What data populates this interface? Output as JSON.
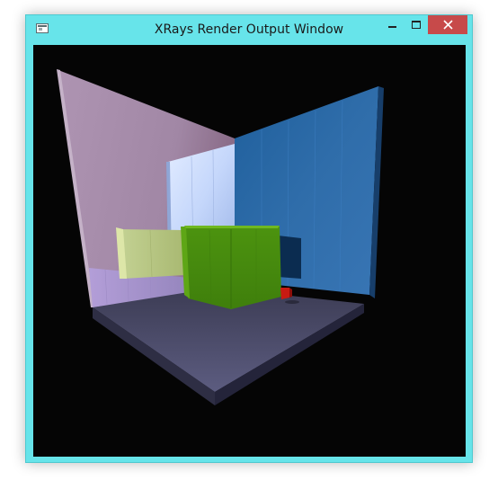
{
  "window": {
    "title": "XRays Render Output Window",
    "frame_color": "#67e4ea",
    "close_button_color": "#c74a4a"
  },
  "titlebar": {
    "app_icon": "window-app-icon",
    "minimize_icon": "minimize-icon",
    "maximize_icon": "maximize-icon",
    "close_icon": "close-icon"
  },
  "scene": {
    "background": "#050505",
    "left_wall_color": "#a58aa8",
    "back_wall_color": "#2c6aa7",
    "floor_color": "#4a4a6a",
    "light_panel_color": "#b8cdf6",
    "yellow_box_color": "#b9c886",
    "green_box_color": "#4a8d12",
    "red_cube_color": "#c81a12"
  }
}
